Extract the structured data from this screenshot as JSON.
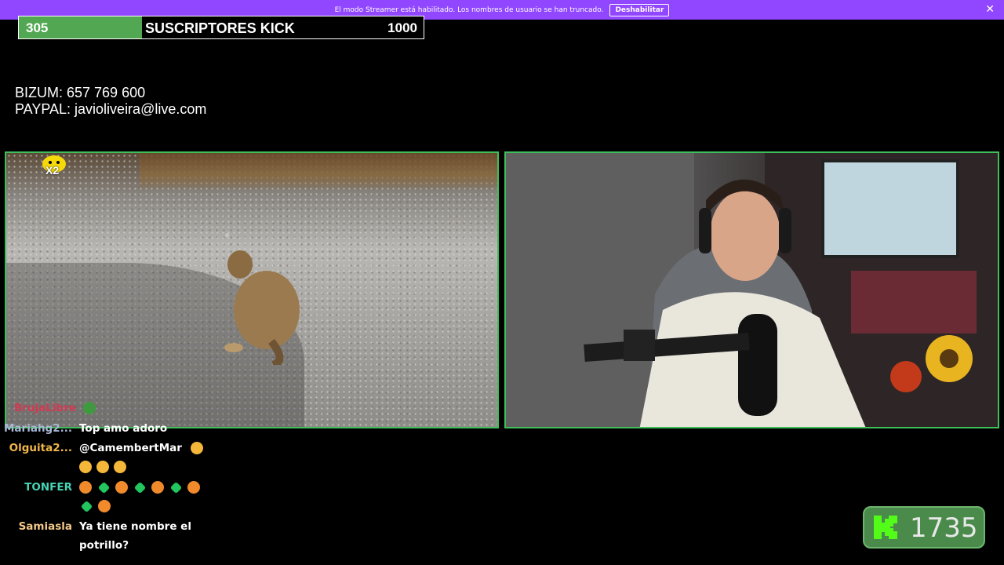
{
  "banner": {
    "message": "El modo Streamer está habilitado. Los nombres de usuario se han truncado.",
    "button_label": "Deshabilitar",
    "close_icon": "close-icon"
  },
  "sub_goal": {
    "current": "305",
    "label": "SUSCRIPTORES KICK",
    "target": "1000",
    "progress_fraction": 0.305,
    "fill_color": "#52a852"
  },
  "donate": {
    "bizum": "BIZUM: 657 769 600",
    "paypal": "PAYPAL: javioliveira@live.com"
  },
  "left_video": {
    "mascot_label": "X2"
  },
  "chat": {
    "top_username": "BrujaLibre",
    "messages": [
      {
        "user": "Mariahg2...",
        "color": "#a9b8d6",
        "text": "Top amo adoro"
      },
      {
        "user": "Olguita2...",
        "color": "#f0b64a",
        "text": "@CamembertMar"
      },
      {
        "user": "TONFER",
        "color": "#47d4b4",
        "text": ""
      },
      {
        "user": "Samiasla",
        "color": "#f3c88a",
        "text": "Ya tiene nombre el potrillo?"
      }
    ]
  },
  "kick_badge": {
    "count": "1735",
    "accent": "#53fc18"
  }
}
